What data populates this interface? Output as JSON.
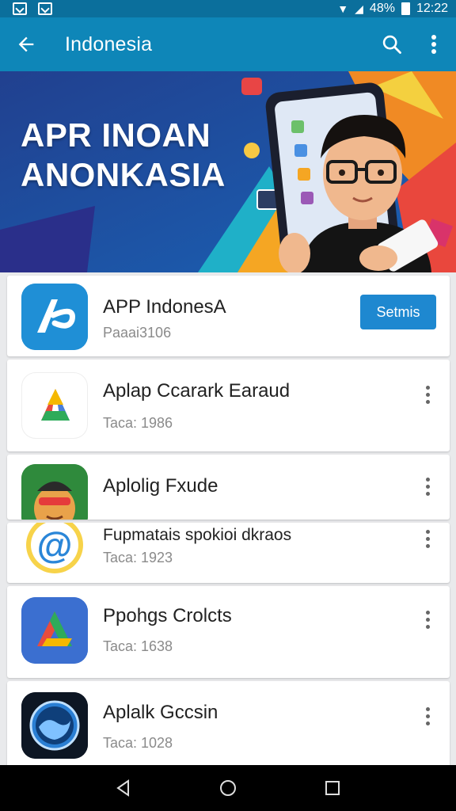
{
  "status_bar": {
    "battery_text": "48%",
    "time": "12:22"
  },
  "app_bar": {
    "title": "Indonesia"
  },
  "banner": {
    "headline_line1": "APR INOAN",
    "headline_line2": "ANONKASIA"
  },
  "apps": [
    {
      "name": "APP IndonesA",
      "meta": "Paaai3106",
      "action_label": "Setmis"
    },
    {
      "name": "Aplap Ccarark Earaud",
      "meta": "Taca: 1986"
    },
    {
      "name": "Aplolig Fxude",
      "meta": ""
    },
    {
      "name": "Fupmatais spokioi dkraos",
      "meta": "Taca: 1923"
    },
    {
      "name": "Ppohgs Crolcts",
      "meta": "Taca: 1638"
    },
    {
      "name": "Aplalk Gccsin",
      "meta": "Taca: 1028"
    }
  ],
  "colors": {
    "app_bar": "#0e86b8",
    "status_bar": "#0b6f9c",
    "accent_button": "#1e88d0"
  }
}
